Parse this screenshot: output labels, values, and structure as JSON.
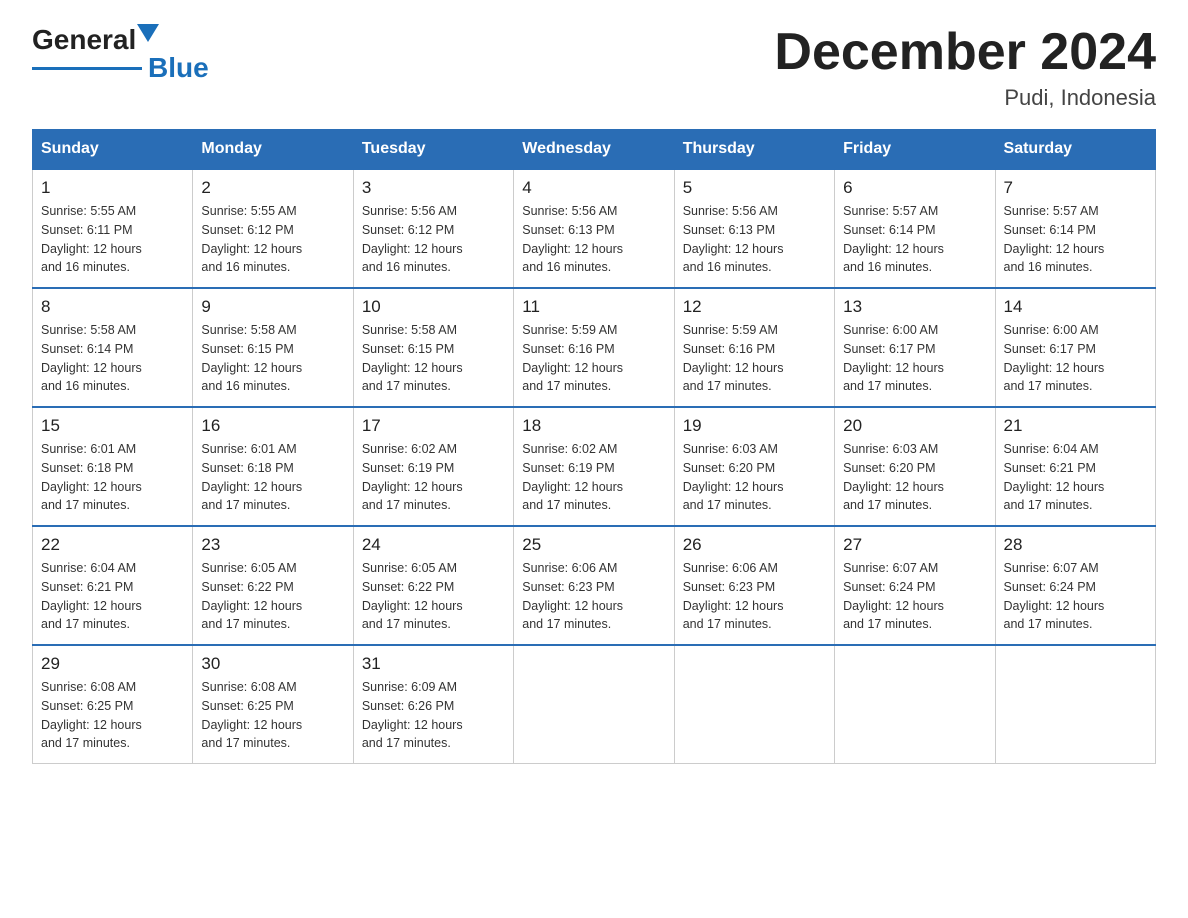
{
  "header": {
    "title": "December 2024",
    "subtitle": "Pudi, Indonesia",
    "logo_general": "General",
    "logo_blue": "Blue"
  },
  "weekdays": [
    "Sunday",
    "Monday",
    "Tuesday",
    "Wednesday",
    "Thursday",
    "Friday",
    "Saturday"
  ],
  "weeks": [
    [
      {
        "day": 1,
        "sunrise": "5:55 AM",
        "sunset": "6:11 PM",
        "daylight": "12 hours and 16 minutes."
      },
      {
        "day": 2,
        "sunrise": "5:55 AM",
        "sunset": "6:12 PM",
        "daylight": "12 hours and 16 minutes."
      },
      {
        "day": 3,
        "sunrise": "5:56 AM",
        "sunset": "6:12 PM",
        "daylight": "12 hours and 16 minutes."
      },
      {
        "day": 4,
        "sunrise": "5:56 AM",
        "sunset": "6:13 PM",
        "daylight": "12 hours and 16 minutes."
      },
      {
        "day": 5,
        "sunrise": "5:56 AM",
        "sunset": "6:13 PM",
        "daylight": "12 hours and 16 minutes."
      },
      {
        "day": 6,
        "sunrise": "5:57 AM",
        "sunset": "6:14 PM",
        "daylight": "12 hours and 16 minutes."
      },
      {
        "day": 7,
        "sunrise": "5:57 AM",
        "sunset": "6:14 PM",
        "daylight": "12 hours and 16 minutes."
      }
    ],
    [
      {
        "day": 8,
        "sunrise": "5:58 AM",
        "sunset": "6:14 PM",
        "daylight": "12 hours and 16 minutes."
      },
      {
        "day": 9,
        "sunrise": "5:58 AM",
        "sunset": "6:15 PM",
        "daylight": "12 hours and 16 minutes."
      },
      {
        "day": 10,
        "sunrise": "5:58 AM",
        "sunset": "6:15 PM",
        "daylight": "12 hours and 17 minutes."
      },
      {
        "day": 11,
        "sunrise": "5:59 AM",
        "sunset": "6:16 PM",
        "daylight": "12 hours and 17 minutes."
      },
      {
        "day": 12,
        "sunrise": "5:59 AM",
        "sunset": "6:16 PM",
        "daylight": "12 hours and 17 minutes."
      },
      {
        "day": 13,
        "sunrise": "6:00 AM",
        "sunset": "6:17 PM",
        "daylight": "12 hours and 17 minutes."
      },
      {
        "day": 14,
        "sunrise": "6:00 AM",
        "sunset": "6:17 PM",
        "daylight": "12 hours and 17 minutes."
      }
    ],
    [
      {
        "day": 15,
        "sunrise": "6:01 AM",
        "sunset": "6:18 PM",
        "daylight": "12 hours and 17 minutes."
      },
      {
        "day": 16,
        "sunrise": "6:01 AM",
        "sunset": "6:18 PM",
        "daylight": "12 hours and 17 minutes."
      },
      {
        "day": 17,
        "sunrise": "6:02 AM",
        "sunset": "6:19 PM",
        "daylight": "12 hours and 17 minutes."
      },
      {
        "day": 18,
        "sunrise": "6:02 AM",
        "sunset": "6:19 PM",
        "daylight": "12 hours and 17 minutes."
      },
      {
        "day": 19,
        "sunrise": "6:03 AM",
        "sunset": "6:20 PM",
        "daylight": "12 hours and 17 minutes."
      },
      {
        "day": 20,
        "sunrise": "6:03 AM",
        "sunset": "6:20 PM",
        "daylight": "12 hours and 17 minutes."
      },
      {
        "day": 21,
        "sunrise": "6:04 AM",
        "sunset": "6:21 PM",
        "daylight": "12 hours and 17 minutes."
      }
    ],
    [
      {
        "day": 22,
        "sunrise": "6:04 AM",
        "sunset": "6:21 PM",
        "daylight": "12 hours and 17 minutes."
      },
      {
        "day": 23,
        "sunrise": "6:05 AM",
        "sunset": "6:22 PM",
        "daylight": "12 hours and 17 minutes."
      },
      {
        "day": 24,
        "sunrise": "6:05 AM",
        "sunset": "6:22 PM",
        "daylight": "12 hours and 17 minutes."
      },
      {
        "day": 25,
        "sunrise": "6:06 AM",
        "sunset": "6:23 PM",
        "daylight": "12 hours and 17 minutes."
      },
      {
        "day": 26,
        "sunrise": "6:06 AM",
        "sunset": "6:23 PM",
        "daylight": "12 hours and 17 minutes."
      },
      {
        "day": 27,
        "sunrise": "6:07 AM",
        "sunset": "6:24 PM",
        "daylight": "12 hours and 17 minutes."
      },
      {
        "day": 28,
        "sunrise": "6:07 AM",
        "sunset": "6:24 PM",
        "daylight": "12 hours and 17 minutes."
      }
    ],
    [
      {
        "day": 29,
        "sunrise": "6:08 AM",
        "sunset": "6:25 PM",
        "daylight": "12 hours and 17 minutes."
      },
      {
        "day": 30,
        "sunrise": "6:08 AM",
        "sunset": "6:25 PM",
        "daylight": "12 hours and 17 minutes."
      },
      {
        "day": 31,
        "sunrise": "6:09 AM",
        "sunset": "6:26 PM",
        "daylight": "12 hours and 17 minutes."
      },
      null,
      null,
      null,
      null
    ]
  ]
}
